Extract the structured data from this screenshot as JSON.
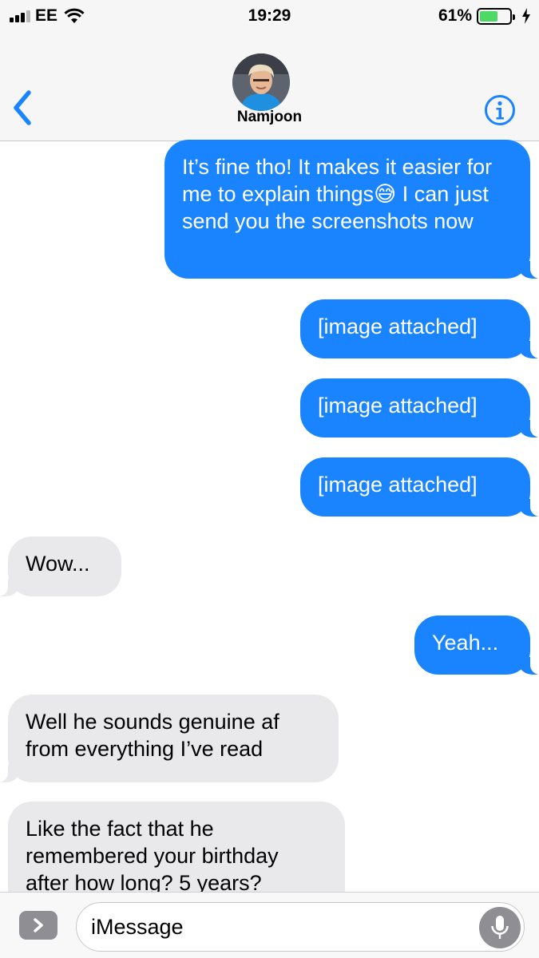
{
  "status_bar": {
    "carrier": "EE",
    "time": "19:29",
    "battery_percent": "61%",
    "battery_level": 0.61,
    "charging": true
  },
  "header": {
    "contact_name": "Namjoon",
    "back_icon": "chevron-left-icon",
    "info_icon": "info-icon"
  },
  "colors": {
    "outgoing_bubble": "#1a84ff",
    "incoming_bubble": "#e9e9eb",
    "accent": "#1a84ff"
  },
  "messages": [
    {
      "direction": "outgoing",
      "text": "It’s fine tho! It makes it easier for me to explain things😅 I can just send you the screenshots now"
    },
    {
      "direction": "outgoing",
      "text": "[image attached]"
    },
    {
      "direction": "outgoing",
      "text": "[image attached]"
    },
    {
      "direction": "outgoing",
      "text": "[image attached]"
    },
    {
      "direction": "incoming",
      "text": "Wow..."
    },
    {
      "direction": "outgoing",
      "text": "Yeah..."
    },
    {
      "direction": "incoming",
      "text": "Well he sounds genuine af from everything I’ve read"
    },
    {
      "direction": "incoming",
      "text": "Like the fact that he remembered your birthday after how long? 5 years?"
    }
  ],
  "composer": {
    "placeholder": "iMessage",
    "value": ""
  }
}
